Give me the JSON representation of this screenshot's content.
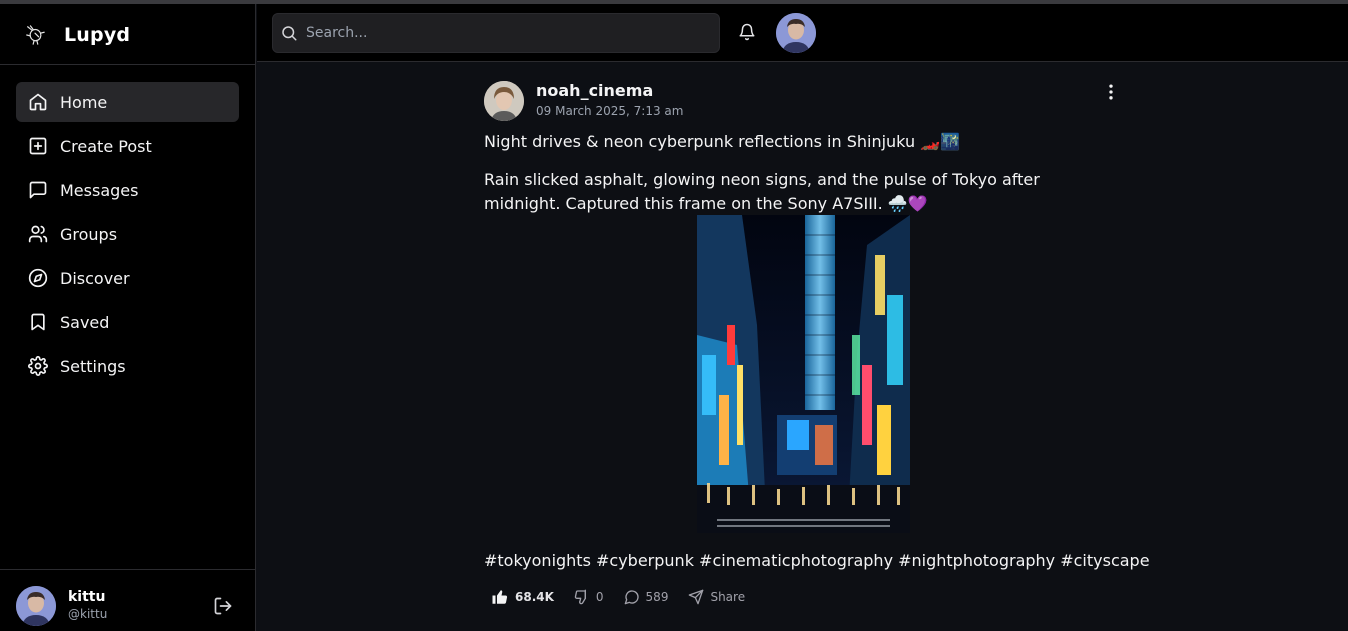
{
  "app": {
    "name": "Lupyd"
  },
  "sidebar": {
    "items": [
      {
        "label": "Home",
        "icon": "home-icon",
        "active": true
      },
      {
        "label": "Create Post",
        "icon": "plus-square-icon"
      },
      {
        "label": "Messages",
        "icon": "message-square-icon"
      },
      {
        "label": "Groups",
        "icon": "users-icon"
      },
      {
        "label": "Discover",
        "icon": "compass-icon"
      },
      {
        "label": "Saved",
        "icon": "bookmark-icon"
      },
      {
        "label": "Settings",
        "icon": "gear-icon"
      }
    ],
    "user": {
      "name": "kittu",
      "handle": "@kittu"
    }
  },
  "header": {
    "search_placeholder": "Search..."
  },
  "post": {
    "author": "noah_cinema",
    "date": "09 March 2025, 7:13 am",
    "title": "Night drives & neon cyberpunk reflections in Shinjuku 🏎️🌃",
    "body": "Rain slicked asphalt, glowing neon signs, and the pulse of Tokyo after midnight. Captured this frame on the Sony A7SIII. 🌧️💜",
    "tags": "#tokyonights #cyberpunk #cinematicphotography #nightphotography #cityscape",
    "likes": "68.4K",
    "dislikes": "0",
    "comments": "589",
    "share_label": "Share"
  },
  "colors": {
    "background": "#0d0f14",
    "sidebar": "#000000",
    "active_item": "#27272a",
    "search": "#1f1f22",
    "muted_text": "#9ca3af"
  }
}
